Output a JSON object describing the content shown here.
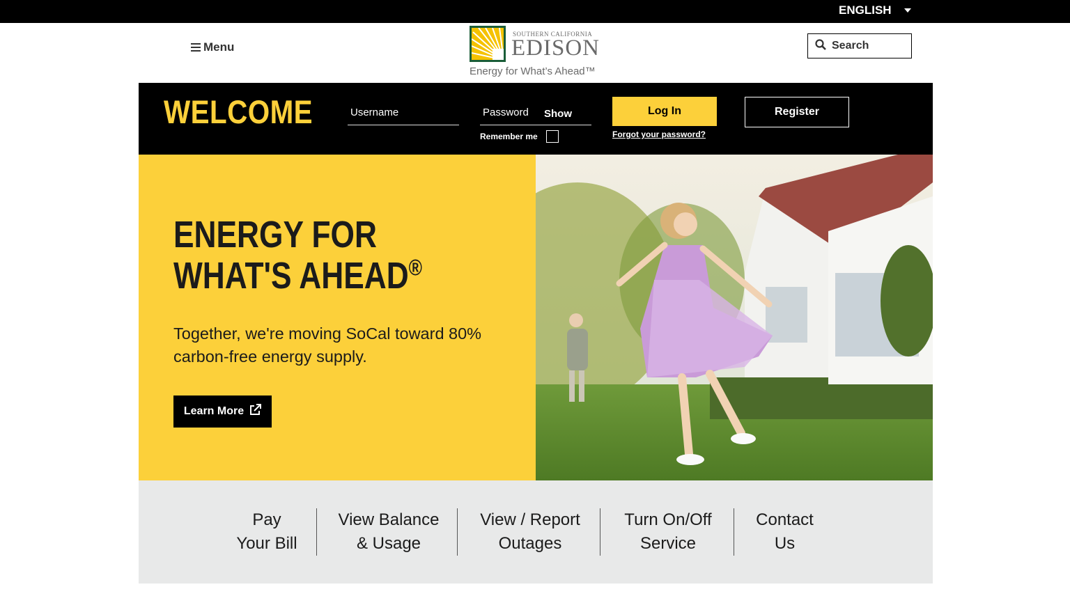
{
  "language": {
    "label": "ENGLISH"
  },
  "header": {
    "menu_label": "Menu",
    "logo": {
      "small": "SOUTHERN CALIFORNIA",
      "big": "EDISON",
      "tagline": "Energy for What’s Ahead™"
    },
    "search_label": "Search"
  },
  "login": {
    "welcome": "WELCOME",
    "username_placeholder": "Username",
    "password_placeholder": "Password",
    "show_label": "Show",
    "remember_label": "Remember me",
    "login_label": "Log In",
    "forgot_label": "Forgot your password?",
    "register_label": "Register"
  },
  "hero": {
    "title_main": "ENERGY FOR WHAT'S AHEAD",
    "title_mark": "®",
    "subtitle": "Together, we're moving SoCal toward 80% carbon-free energy supply.",
    "cta_label": "Learn More",
    "cta_icon": "external-link-icon"
  },
  "quick_links": [
    {
      "line1": "Pay",
      "line2": "Your Bill"
    },
    {
      "line1": "View Balance",
      "line2": "& Usage"
    },
    {
      "line1": "View / Report",
      "line2": "Outages"
    },
    {
      "line1": "Turn On/Off",
      "line2": "Service"
    },
    {
      "line1": "Contact",
      "line2": "Us"
    }
  ],
  "colors": {
    "brand_yellow": "#fcd03a",
    "black": "#000000",
    "light_gray": "#e8e9e9",
    "logo_green": "#1a5d38"
  }
}
